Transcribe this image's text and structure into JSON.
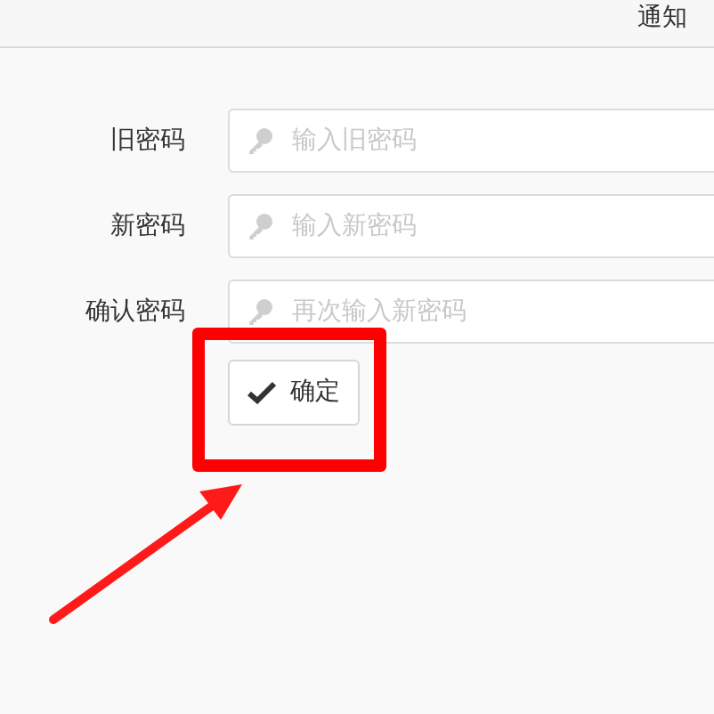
{
  "header": {
    "notifications": "通知"
  },
  "fields": [
    {
      "label": "旧密码",
      "placeholder": "输入旧密码"
    },
    {
      "label": "新密码",
      "placeholder": "输入新密码"
    },
    {
      "label": "确认密码",
      "placeholder": "再次输入新密码"
    }
  ],
  "submit_button": {
    "label": "确定"
  }
}
